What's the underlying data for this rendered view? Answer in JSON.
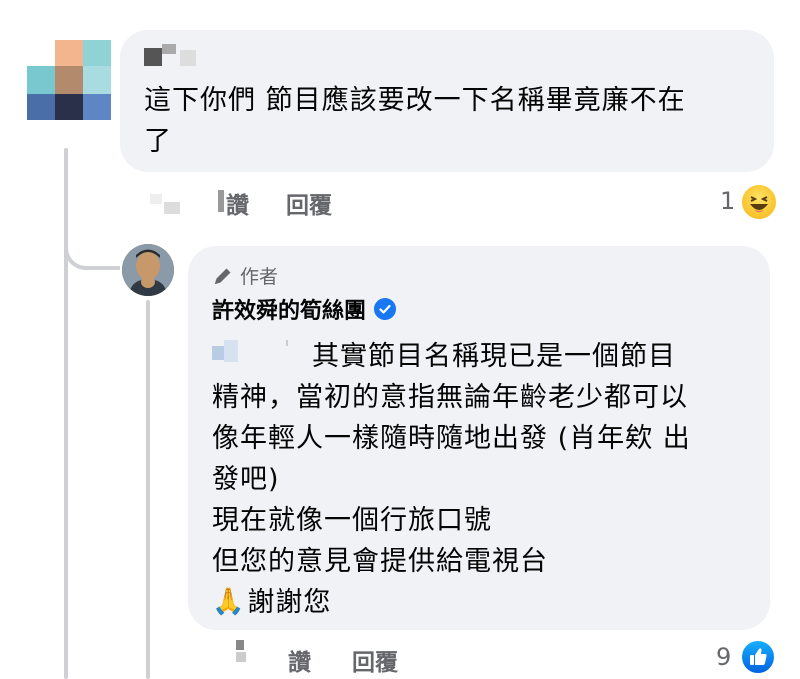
{
  "comment1": {
    "text_line1": "這下你們 節目應該要改一下名稱畢竟廉不在",
    "text_line2": "了",
    "actions": {
      "like": "讚",
      "reply": "回覆"
    },
    "reaction_count": "1",
    "reaction_icon": "haha-icon"
  },
  "reply1": {
    "author_badge": "作者",
    "author_name": "許效舜的筍絲團",
    "lines": [
      "其實節目名稱現已是一個節目",
      "精神，當初的意指無論年齡老少都可以",
      "像年輕人一樣隨時隨地出發 (肖年欸 出",
      "發吧)",
      "現在就像一個行旅口號",
      "但您的意見會提供給電視台",
      "謝謝您"
    ],
    "emoji": "🙏",
    "actions": {
      "like": "讚",
      "reply": "回覆"
    },
    "reaction_count": "9",
    "reaction_icon": "like-icon"
  },
  "colors": {
    "bubble": "#f0f2f5",
    "muted": "#65676b",
    "like_blue": "#1877f2",
    "thread": "#ced0d4"
  }
}
